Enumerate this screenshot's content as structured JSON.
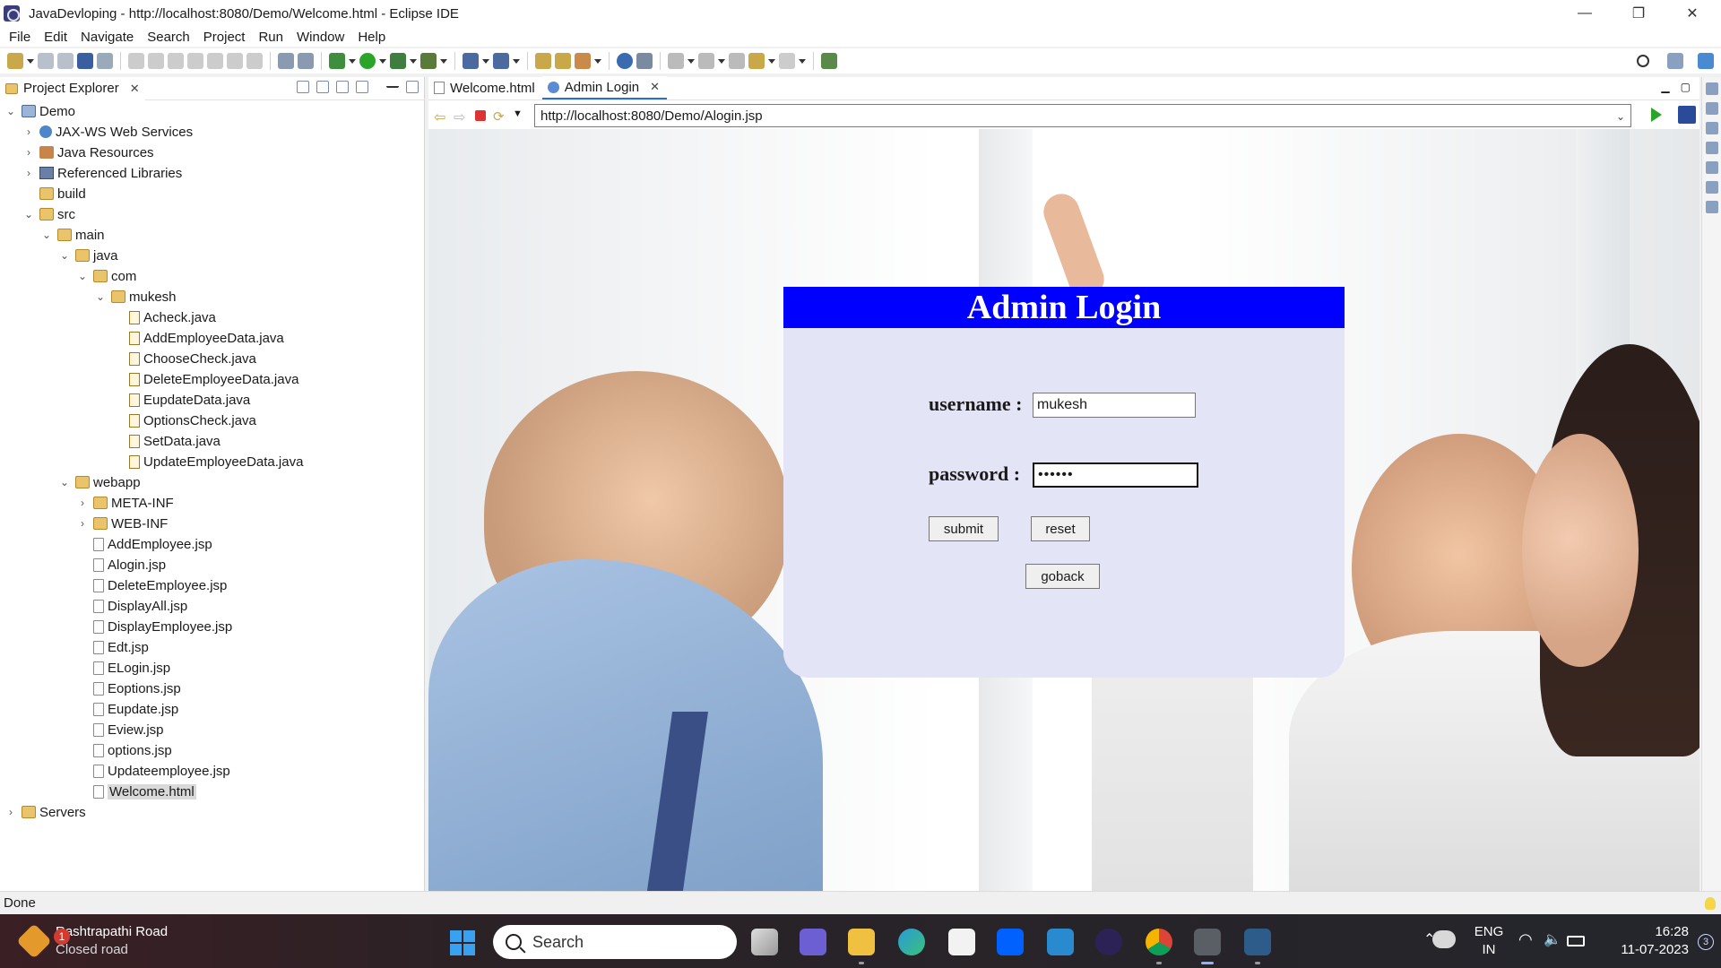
{
  "window": {
    "title": "JavaDevloping - http://localhost:8080/Demo/Welcome.html - Eclipse IDE",
    "controls": {
      "minimize": "—",
      "restore": "❐",
      "close": "✕"
    }
  },
  "menu": [
    "File",
    "Edit",
    "Navigate",
    "Search",
    "Project",
    "Run",
    "Window",
    "Help"
  ],
  "project_explorer": {
    "title": "Project Explorer",
    "tree": [
      {
        "label": "Demo",
        "icon": "project-icon",
        "expanded": true
      },
      {
        "label": "JAX-WS Web Services",
        "icon": "web-services-icon",
        "expanded": false
      },
      {
        "label": "Java Resources",
        "icon": "java-resources-icon",
        "expanded": false
      },
      {
        "label": "Referenced Libraries",
        "icon": "library-icon",
        "expanded": false
      },
      {
        "label": "build",
        "icon": "folder-icon"
      },
      {
        "label": "src",
        "icon": "folder-icon",
        "expanded": true
      },
      {
        "label": "main",
        "icon": "folder-icon",
        "expanded": true
      },
      {
        "label": "java",
        "icon": "folder-icon",
        "expanded": true
      },
      {
        "label": "com",
        "icon": "folder-icon",
        "expanded": true
      },
      {
        "label": "mukesh",
        "icon": "folder-icon",
        "expanded": true
      },
      {
        "label": "Acheck.java",
        "icon": "java-file-icon"
      },
      {
        "label": "AddEmployeeData.java",
        "icon": "java-file-icon"
      },
      {
        "label": "ChooseCheck.java",
        "icon": "java-file-icon"
      },
      {
        "label": "DeleteEmployeeData.java",
        "icon": "java-file-icon"
      },
      {
        "label": "EupdateData.java",
        "icon": "java-file-icon"
      },
      {
        "label": "OptionsCheck.java",
        "icon": "java-file-icon"
      },
      {
        "label": "SetData.java",
        "icon": "java-file-icon"
      },
      {
        "label": "UpdateEmployeeData.java",
        "icon": "java-file-icon"
      },
      {
        "label": "webapp",
        "icon": "folder-icon",
        "expanded": true
      },
      {
        "label": "META-INF",
        "icon": "folder-icon",
        "expanded": false
      },
      {
        "label": "WEB-INF",
        "icon": "folder-icon",
        "expanded": false
      },
      {
        "label": "AddEmployee.jsp",
        "icon": "jsp-file-icon"
      },
      {
        "label": "Alogin.jsp",
        "icon": "jsp-file-icon"
      },
      {
        "label": "DeleteEmployee.jsp",
        "icon": "jsp-file-icon"
      },
      {
        "label": "DisplayAll.jsp",
        "icon": "jsp-file-icon"
      },
      {
        "label": "DisplayEmployee.jsp",
        "icon": "jsp-file-icon"
      },
      {
        "label": "Edt.jsp",
        "icon": "jsp-file-icon"
      },
      {
        "label": "ELogin.jsp",
        "icon": "jsp-file-icon"
      },
      {
        "label": "Eoptions.jsp",
        "icon": "jsp-file-icon"
      },
      {
        "label": "Eupdate.jsp",
        "icon": "jsp-file-icon"
      },
      {
        "label": "Eview.jsp",
        "icon": "jsp-file-icon"
      },
      {
        "label": "options.jsp",
        "icon": "jsp-file-icon"
      },
      {
        "label": "Updateemployee.jsp",
        "icon": "jsp-file-icon"
      },
      {
        "label": "Welcome.html",
        "icon": "html-file-icon",
        "selected": true
      },
      {
        "label": "Servers",
        "icon": "folder-icon",
        "expanded": false
      }
    ]
  },
  "editor": {
    "tabs": [
      {
        "label": "Welcome.html",
        "active": false
      },
      {
        "label": "Admin Login",
        "active": true
      }
    ],
    "url": "http://localhost:8080/Demo/Alogin.jsp"
  },
  "login_page": {
    "heading": "Admin Login",
    "username_label": "username :",
    "username_value": "mukesh",
    "password_label": "password :",
    "password_value": "••••••",
    "submit_label": "submit",
    "reset_label": "reset",
    "goback_label": "goback",
    "header_color": "#0000ff",
    "card_color": "#e4e4f7"
  },
  "status": {
    "text": "Done"
  },
  "taskbar": {
    "weather_title": "Rashtrapathi Road",
    "weather_subtitle": "Closed road",
    "weather_badge": "1",
    "search_placeholder": "Search",
    "language_line1": "ENG",
    "language_line2": "IN",
    "time": "16:28",
    "date": "11-07-2023",
    "notification_count": "3",
    "apps": [
      "task-view-icon",
      "chat-icon",
      "file-explorer-icon",
      "edge-icon",
      "store-icon",
      "dropbox-icon",
      "mysql-icon",
      "eclipse-icon",
      "chrome-icon",
      "settings-icon",
      "mysql-workbench-icon"
    ]
  }
}
